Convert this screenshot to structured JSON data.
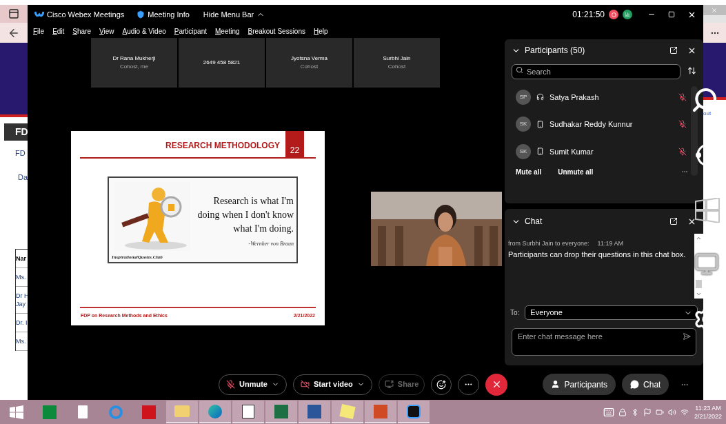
{
  "browser_left": {
    "header_fragment": "FD",
    "page_fragments": [
      "FD",
      "Da"
    ],
    "table_fragments": [
      "Nar",
      "Ms.",
      "Dr H\nJay",
      "Dr. I",
      "Ms."
    ]
  },
  "browser_right": {
    "link_fragment": "out"
  },
  "window": {
    "app_name": "Cisco Webex Meetings",
    "meeting_info": "Meeting Info",
    "hide_menu_bar": "Hide Menu Bar",
    "timer": "01:21:50"
  },
  "menu": [
    "File",
    "Edit",
    "Share",
    "View",
    "Audio & Video",
    "Participant",
    "Meeting",
    "Breakout Sessions",
    "Help"
  ],
  "tiles": [
    {
      "name": "Dr Rana Mukherji",
      "role": "Cohost, me"
    },
    {
      "name": "2649 458 5821"
    },
    {
      "name": "Jyotsna Verma",
      "role": "Cohost"
    },
    {
      "name": "Surbhi Jain",
      "role": "Cohost"
    }
  ],
  "slide": {
    "title": "RESEARCH METHODOLOGY",
    "number": "22",
    "quote": "Research is what I'm doing when I don't know what I'm doing.",
    "author": "-Wernher von Braun",
    "credit": "InspirationalQuotes.Club",
    "footer": "FDP on Research Methods and Ethics",
    "date": "2/21/2022"
  },
  "participants_panel": {
    "title": "Participants (50)",
    "search_placeholder": "Search",
    "participants": [
      {
        "initials": "SP",
        "name": "Satya Prakash",
        "kind": "headset",
        "muted": true
      },
      {
        "initials": "SK",
        "name": "Sudhakar Reddy Kunnur",
        "kind": "phone",
        "muted": true
      },
      {
        "initials": "SK",
        "name": "Sumit Kumar",
        "kind": "phone",
        "muted": true
      }
    ],
    "actions": [
      "Mute all",
      "Unmute all"
    ]
  },
  "chat_panel": {
    "title": "Chat",
    "messages": [
      {
        "meta": "from Surbhi Jain to everyone:",
        "time": "11:19 AM",
        "text": "Participants can drop their questions in this chat box."
      }
    ],
    "to_label": "To:",
    "recipient": "Everyone",
    "input_placeholder": "Enter chat message here"
  },
  "controls": [
    {
      "kind": "mute",
      "label": "Unmute",
      "disabled": false
    },
    {
      "kind": "video",
      "label": "Start video",
      "disabled": false
    },
    {
      "kind": "share",
      "label": "Share",
      "disabled": true
    },
    {
      "kind": "reactions"
    },
    {
      "kind": "more"
    },
    {
      "kind": "leave"
    }
  ],
  "side_controls": [
    {
      "kind": "participants",
      "label": "Participants"
    },
    {
      "kind": "chat",
      "label": "Chat"
    }
  ],
  "taskbar": {
    "apps": [
      {
        "kind": "store",
        "running": false
      },
      {
        "kind": "file",
        "running": false
      },
      {
        "kind": "ie",
        "running": false
      },
      {
        "kind": "acrobat",
        "running": false
      },
      {
        "kind": "explorer",
        "running": true
      },
      {
        "kind": "edge",
        "running": true
      },
      {
        "kind": "pen",
        "running": true
      },
      {
        "kind": "excel",
        "running": true
      },
      {
        "kind": "word",
        "running": true
      },
      {
        "kind": "sticky",
        "running": true
      },
      {
        "kind": "powerpoint",
        "running": true
      },
      {
        "kind": "webex",
        "running": true
      }
    ],
    "time": "11:23 AM",
    "date": "2/21/2022"
  }
}
